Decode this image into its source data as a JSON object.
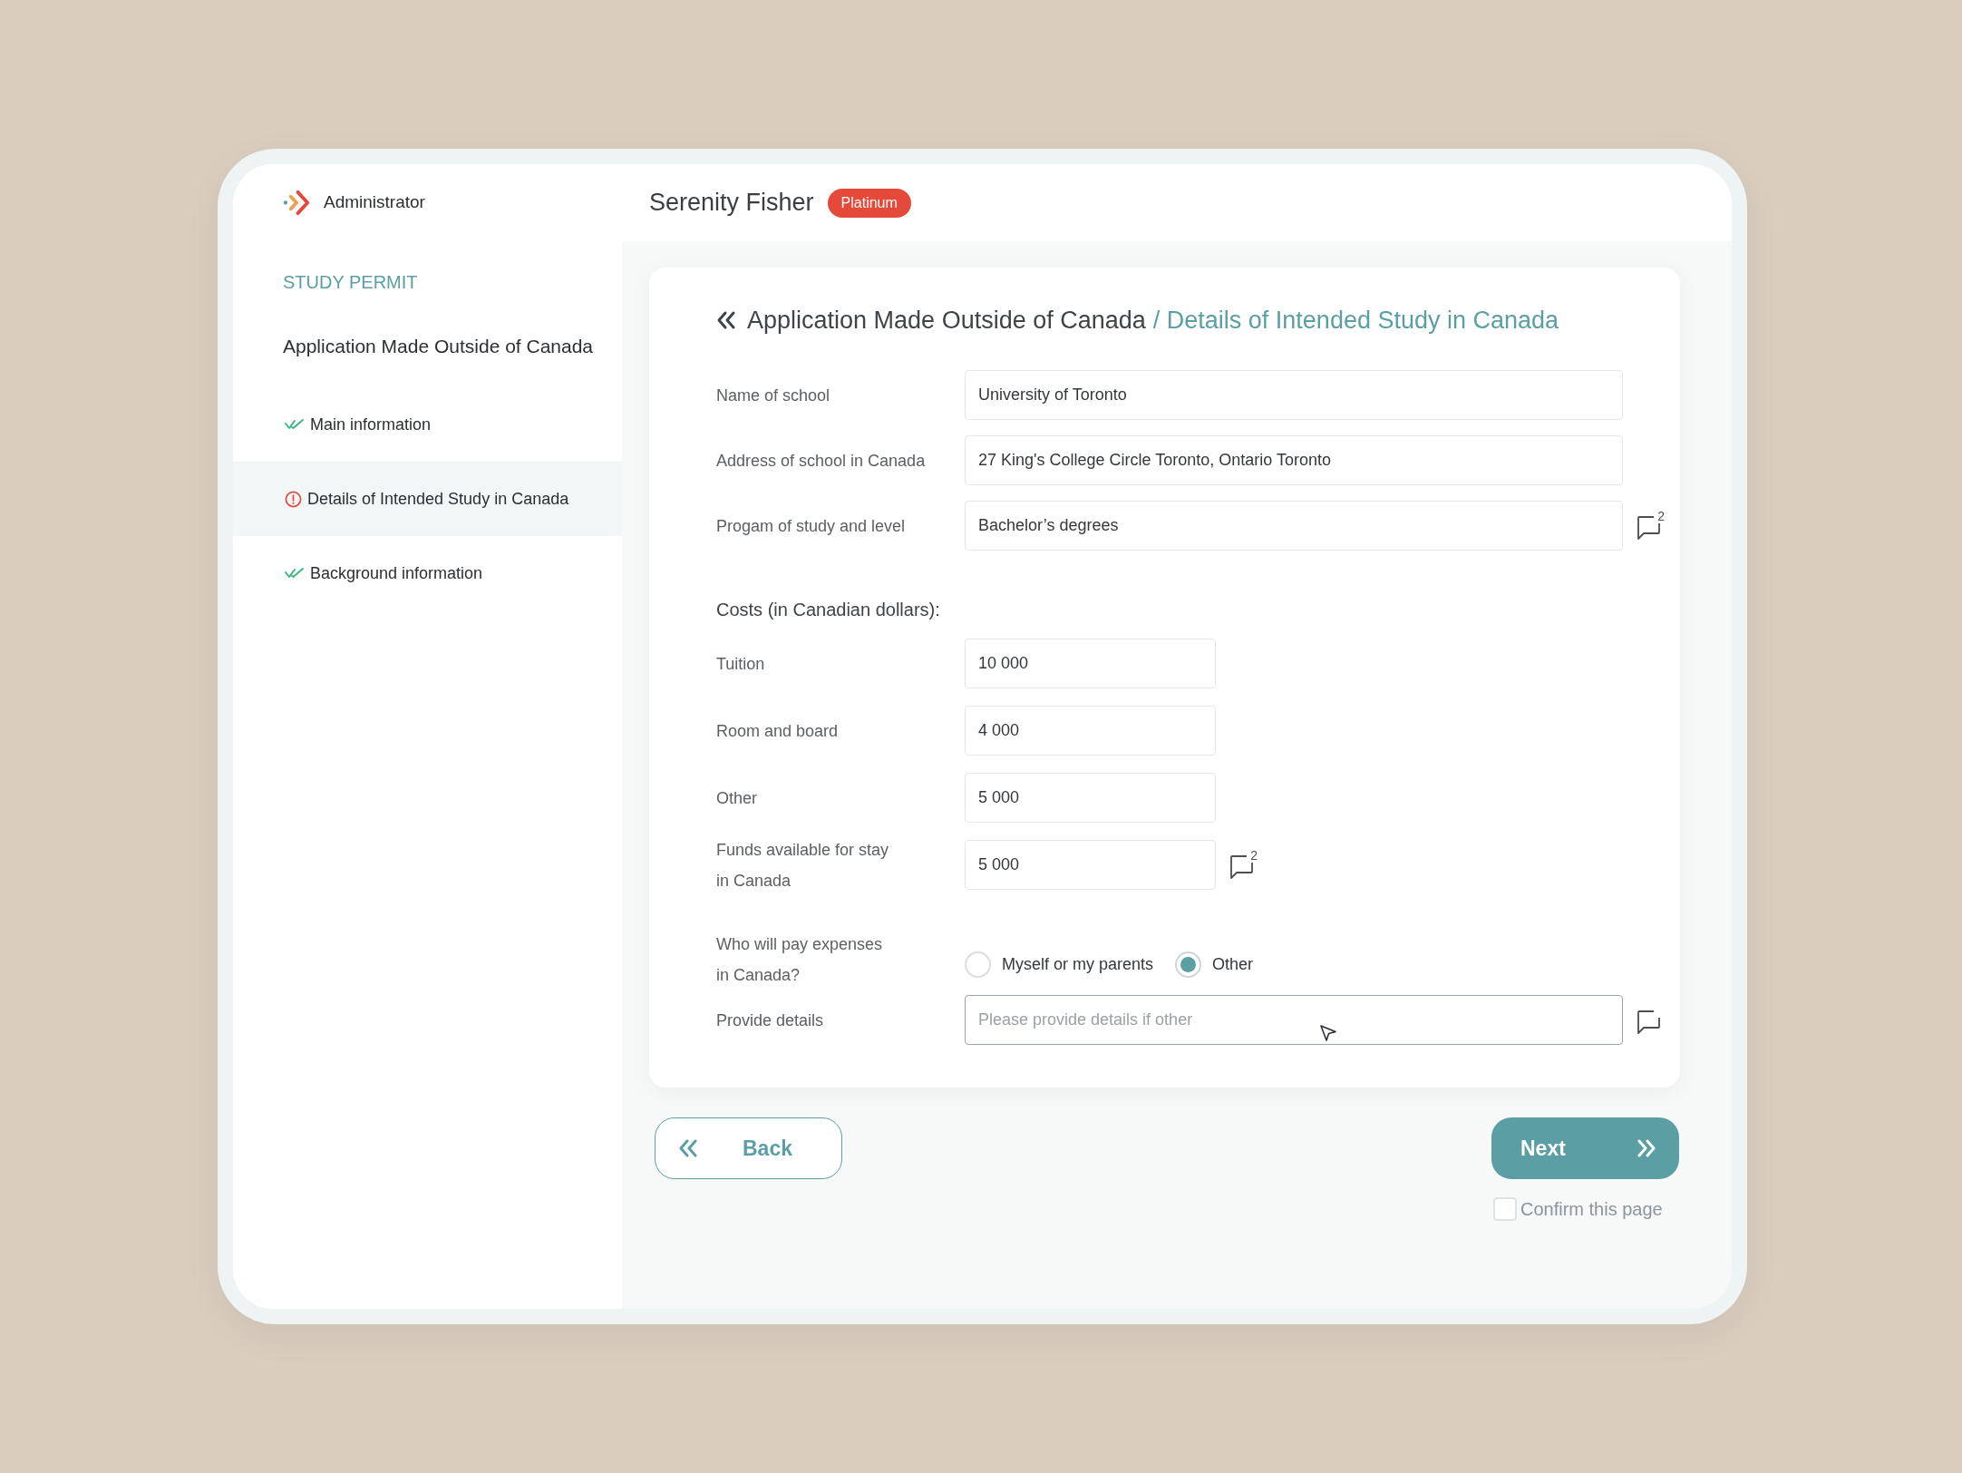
{
  "header": {
    "role": "Administrator",
    "user_name": "Serenity Fisher",
    "plan_badge": "Platinum"
  },
  "sidebar": {
    "section_title": "STUDY PERMIT",
    "group_title": "Application Made Outside of Canada",
    "items": [
      {
        "label": "Main information",
        "complete": true,
        "selected": false
      },
      {
        "label": "Details of Intended Study in Canada",
        "complete": false,
        "selected": true
      },
      {
        "label": "Background information",
        "complete": true,
        "selected": false
      }
    ]
  },
  "form": {
    "breadcrumb": {
      "parent": "Application Made Outside of Canada",
      "current": "/ Details of Intended Study in Canada"
    },
    "school_fields": [
      {
        "label": "Name of school",
        "value": "University of Toronto",
        "comment_button": false
      },
      {
        "label": "Address of school in Canada",
        "value": "27 King's College Circle Toronto, Ontario Toronto",
        "comment_button": false
      },
      {
        "label": "Progam of study and level",
        "value": "Bachelor’s degrees",
        "comment_button": true,
        "comment_count": "2"
      }
    ],
    "costs": {
      "heading": "Costs (in Canadian dollars):",
      "fields": [
        {
          "label": "Tuition",
          "value": "10 000",
          "comment_button": false
        },
        {
          "label": "Room and board",
          "value": "4 000",
          "comment_button": false
        },
        {
          "label": "Other",
          "value": "5 000",
          "comment_button": false
        },
        {
          "label": "Funds available for stay\nin Canada",
          "value": "5 000",
          "comment_button": true,
          "comment_count": "2"
        }
      ]
    },
    "payer": {
      "label": "Who will pay expenses\nin Canada?",
      "options": [
        {
          "label": "Myself or my parents",
          "selected": false
        },
        {
          "label": "Other",
          "selected": true
        }
      ]
    },
    "details": {
      "label": "Provide details",
      "placeholder": "Please provide details if other",
      "focused": true,
      "comment_button": true
    }
  },
  "buttons": {
    "back": "Back",
    "next": "Next"
  },
  "confirm": {
    "label": "Confirm this page",
    "checked": false
  }
}
